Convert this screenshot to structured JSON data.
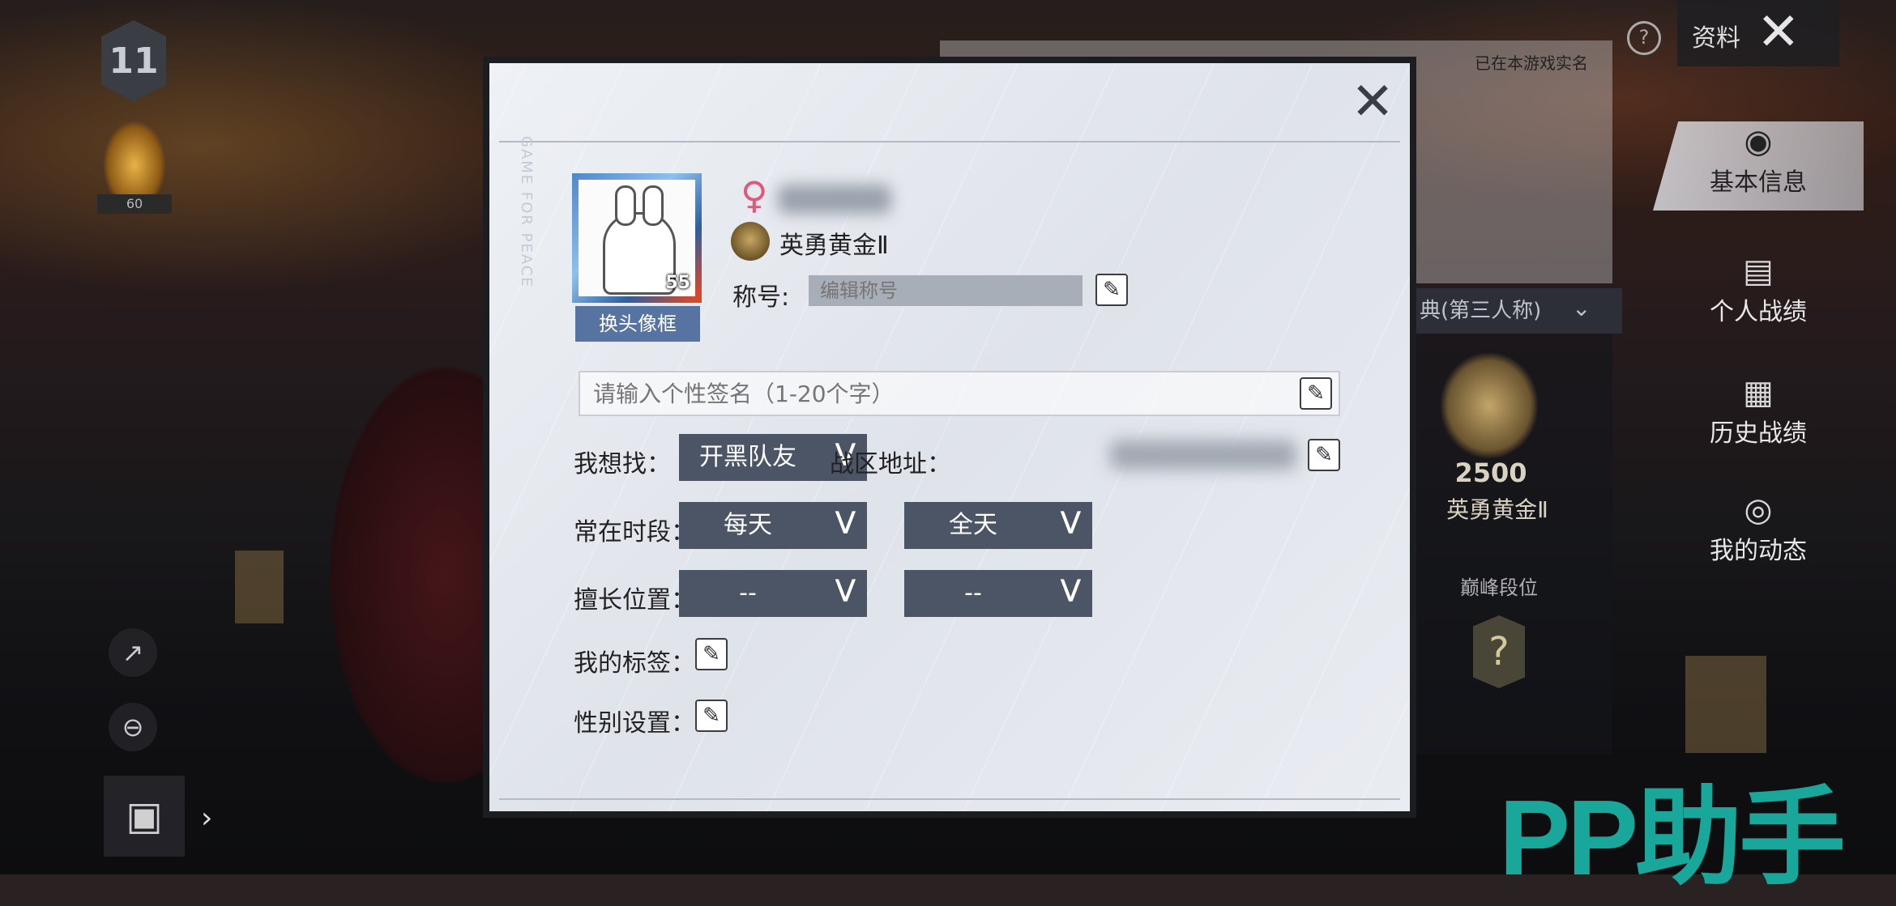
{
  "hud": {
    "level_badge": "11",
    "rank_value": "60"
  },
  "background_panel": {
    "realname_note": "已在本游戏实名",
    "mode_label": "典(第三人称)",
    "rank_score": "2500",
    "rank_name": "英勇黄金Ⅱ",
    "peak_label": "巅峰段位",
    "peak_unknown": "?",
    "top_right_label": "资料"
  },
  "sidenav": {
    "items": [
      {
        "label": "基本信息",
        "icon": "person-icon",
        "active": true
      },
      {
        "label": "个人战绩",
        "icon": "chart-icon",
        "active": false
      },
      {
        "label": "历史战绩",
        "icon": "document-icon",
        "active": false
      },
      {
        "label": "我的动态",
        "icon": "user-feed-icon",
        "active": false
      }
    ]
  },
  "watermark": {
    "text": "PP助手"
  },
  "modal": {
    "brand_vertical": "GAME FOR PEACE",
    "avatar_level": "55",
    "change_frame_label": "换头像框",
    "gender_symbol": "♀",
    "tier_name": "英勇黄金Ⅱ",
    "title_label": "称号:",
    "title_placeholder": "编辑称号",
    "signature_placeholder": "请输入个性签名（1-20个字）",
    "looking_for_label": "我想找：",
    "looking_for_value": "开黑队友",
    "region_label": "战区地址：",
    "active_time_label": "常在时段：",
    "active_days_value": "每天",
    "active_hours_value": "全天",
    "position_label": "擅长位置：",
    "position_1_value": "--",
    "position_2_value": "--",
    "tags_label": "我的标签：",
    "gender_setting_label": "性别设置："
  },
  "colors": {
    "dropdown_bg": "#4b5566",
    "avatar_button_bg": "#5673a1",
    "gender_pink": "#e0587c",
    "watermark_green": "#18a79a"
  }
}
